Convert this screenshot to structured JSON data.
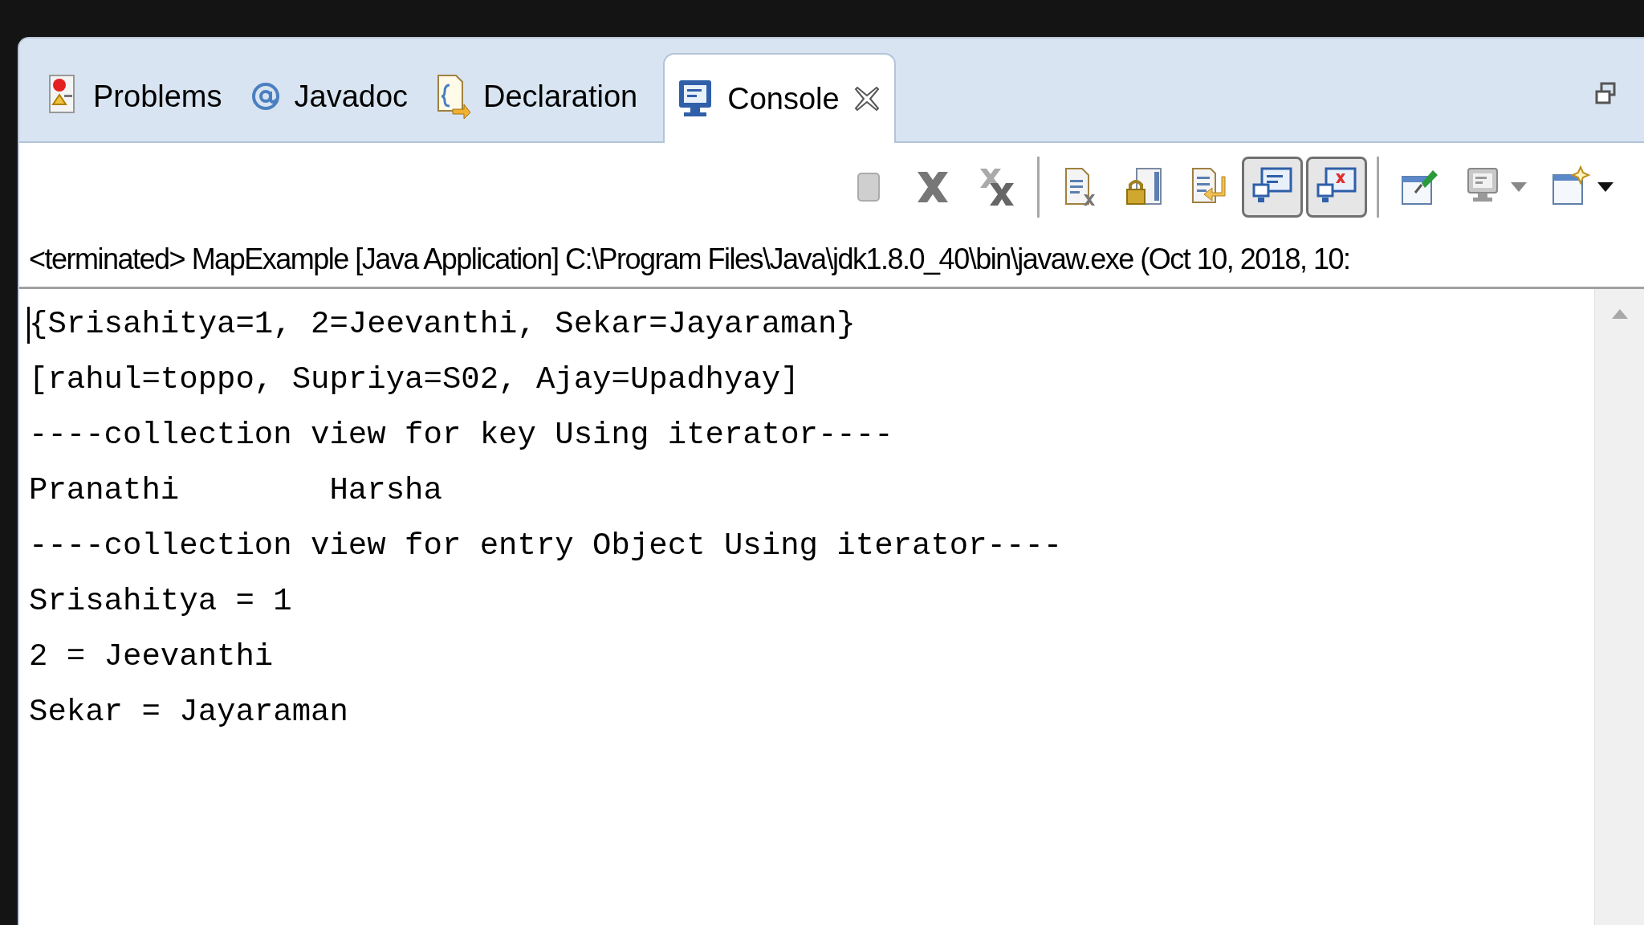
{
  "tabs": [
    {
      "label": "Problems",
      "selected": false
    },
    {
      "label": "Javadoc",
      "selected": false
    },
    {
      "label": "Declaration",
      "selected": false
    },
    {
      "label": "Console",
      "selected": true
    }
  ],
  "toolbar": [
    {
      "kind": "button",
      "on": false,
      "disabled": true
    },
    {
      "kind": "button",
      "on": false,
      "disabled": false
    },
    {
      "kind": "button",
      "on": false,
      "disabled": false
    },
    {
      "kind": "separator"
    },
    {
      "kind": "button",
      "on": false,
      "disabled": false
    },
    {
      "kind": "button",
      "on": false,
      "disabled": false
    },
    {
      "kind": "button",
      "on": false,
      "disabled": false
    },
    {
      "kind": "button",
      "on": true,
      "disabled": false
    },
    {
      "kind": "button",
      "on": true,
      "disabled": false
    },
    {
      "kind": "separator"
    },
    {
      "kind": "button",
      "on": false,
      "disabled": false
    },
    {
      "kind": "dropdown",
      "on": false,
      "disabled": false
    },
    {
      "kind": "dropdown",
      "on": false,
      "disabled": false
    }
  ],
  "status_line": "<terminated> MapExample [Java Application] C:\\Program Files\\Java\\jdk1.8.0_40\\bin\\javaw.exe (Oct 10, 2018, 10:",
  "console_lines": [
    "{Srisahitya=1, 2=Jeevanthi, Sekar=Jayaraman}",
    "[rahul=toppo, Supriya=S02, Ajay=Upadhyay]",
    "----collection view for key Using iterator----",
    "Pranathi        Harsha",
    "----collection view for entry Object Using iterator----",
    "Srisahitya = 1",
    "2 = Jeevanthi",
    "Sekar = Jayaraman"
  ]
}
